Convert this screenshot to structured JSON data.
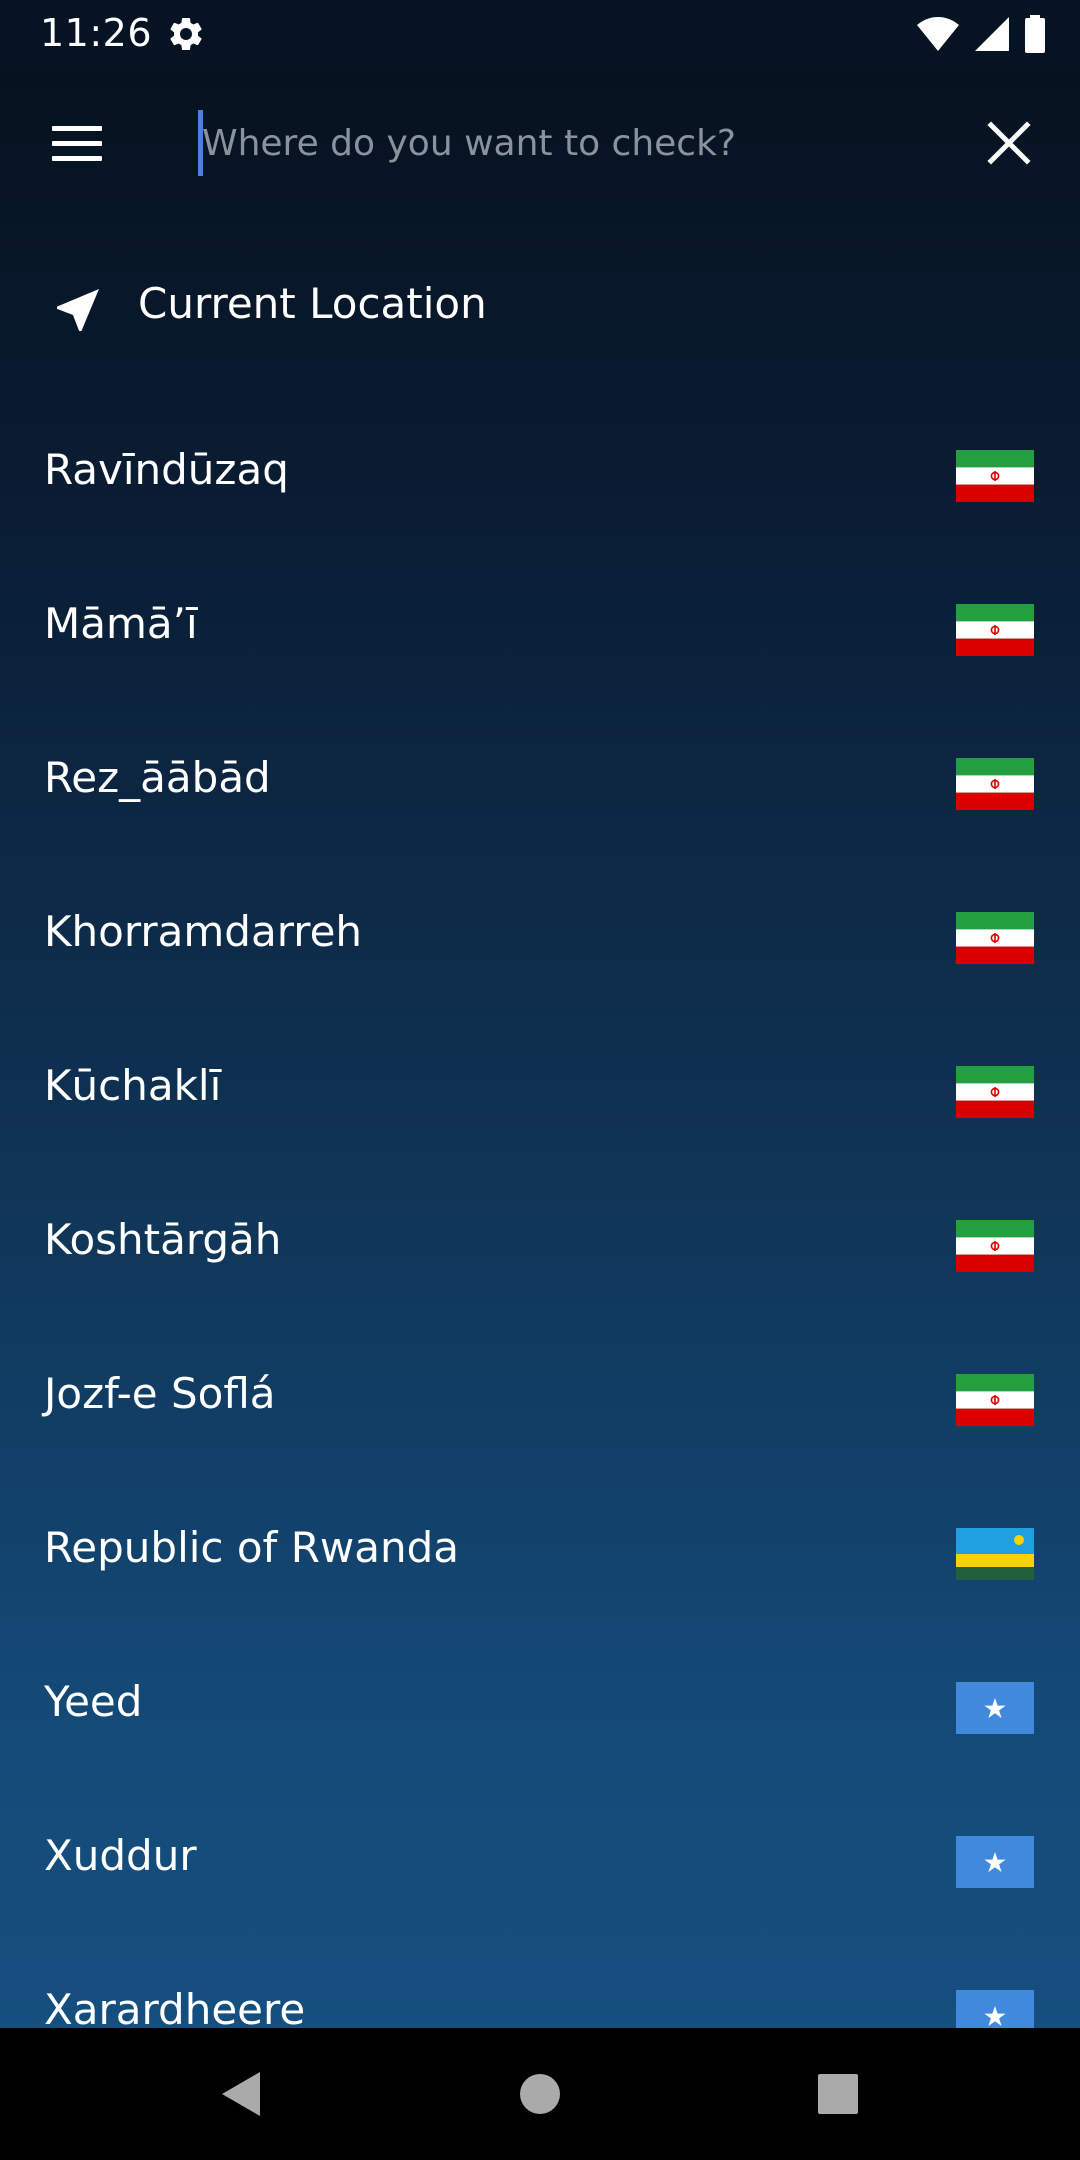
{
  "status_bar": {
    "time": "11:26",
    "icons": [
      "gear-icon",
      "wifi-icon",
      "signal-icon",
      "battery-icon"
    ]
  },
  "search": {
    "placeholder": "Where do you want to check?",
    "value": ""
  },
  "current_location": {
    "label": "Current Location"
  },
  "results": [
    {
      "name": "Ravīndūzaq",
      "flag": "iran"
    },
    {
      "name": "Māmā’ī",
      "flag": "iran"
    },
    {
      "name": "Rez_āābād",
      "flag": "iran"
    },
    {
      "name": "Khorramdarreh",
      "flag": "iran"
    },
    {
      "name": "Kūchaklī",
      "flag": "iran"
    },
    {
      "name": "Koshtārgāh",
      "flag": "iran"
    },
    {
      "name": "Jozf-e Soflá",
      "flag": "iran"
    },
    {
      "name": "Republic of Rwanda",
      "flag": "rwanda"
    },
    {
      "name": "Yeed",
      "flag": "somalia"
    },
    {
      "name": "Xuddur",
      "flag": "somalia"
    },
    {
      "name": "Xarardheere",
      "flag": "somalia"
    }
  ],
  "colors": {
    "accent_caret": "#4a7fe8",
    "background_top": "#06121f",
    "background_bottom": "#154f7f",
    "placeholder": "#8a939d"
  },
  "nav_bar": {
    "buttons": [
      "back-icon",
      "home-icon",
      "recents-icon"
    ]
  }
}
